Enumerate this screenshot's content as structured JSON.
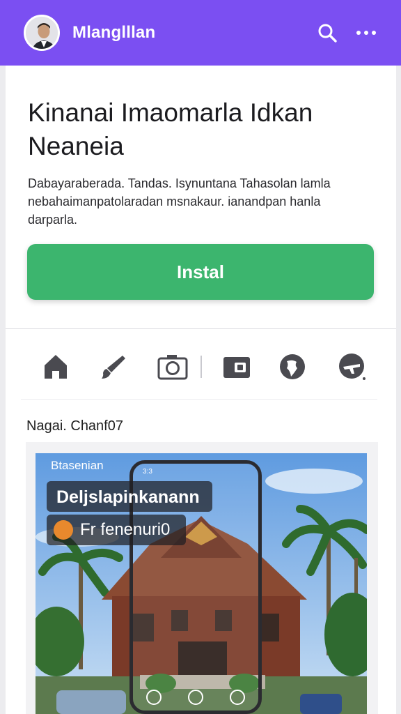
{
  "header": {
    "app_title": "Mlanglllan",
    "accent_color": "#7b4ff2",
    "search_icon": "search-icon",
    "more_icon": "more-horizontal-icon"
  },
  "content": {
    "headline": "Kinanai Imaomarla Idkan Neaneia",
    "description": "Dabayaraberada. Tandas. Isynuntana Tahasolan lamla nebahaimanpatolaradan msnakaur. ianandpan hanla darparla.",
    "install_label": "Instal",
    "install_color": "#3cb56e"
  },
  "iconbar": {
    "items": [
      {
        "name": "home-icon"
      },
      {
        "name": "brush-icon"
      },
      {
        "name": "camera-icon"
      },
      {
        "name": "wallet-icon"
      },
      {
        "name": "globe-icon"
      },
      {
        "name": "airplane-icon"
      }
    ]
  },
  "section": {
    "label": "Nagai. Chanf07"
  },
  "media": {
    "chip_text": "Btasenian",
    "panel_title": "Deljslapinkanann",
    "panel_sub": "Fr fenenuri0",
    "phone_time": "3:3"
  }
}
